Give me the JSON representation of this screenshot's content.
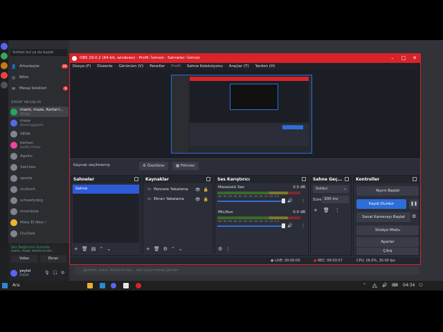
{
  "discord": {
    "search_placeholder": "Sohbet bul ya da başlat",
    "nav": [
      {
        "label": "Arkadaşlar",
        "icon": "friends-icon",
        "badge": "28"
      },
      {
        "label": "Nitro",
        "icon": "nitro-icon",
        "badge": ""
      },
      {
        "label": "Mesaj İstekleri",
        "icon": "mail-icon",
        "badge": "8"
      }
    ],
    "dm_header": "DİREKT MESAJLAR",
    "dms": [
      {
        "name": "mami, maze, Kartal-İ...",
        "sub": "10 Üye",
        "color": "#23a55a"
      },
      {
        "name": "maze",
        "sub": "discord.gg/jakeik",
        "color": "#5865f2"
      },
      {
        "name": "SENA",
        "sub": "",
        "color": "#80848e"
      },
      {
        "name": "berkan",
        "sub": "Spotify dinliyor",
        "color": "#eb459e"
      },
      {
        "name": "Agaitu",
        "sub": "",
        "color": "#80848e"
      },
      {
        "name": "Swichex",
        "sub": "",
        "color": "#80848e"
      },
      {
        "name": "spezia",
        "sub": "",
        "color": "#80848e"
      },
      {
        "name": "ciciksoh",
        "sub": "",
        "color": "#80848e"
      },
      {
        "name": "schawtydog",
        "sub": "",
        "color": "#80848e"
      },
      {
        "name": "moonbow",
        "sub": "",
        "color": "#80848e"
      },
      {
        "name": "Mete El Niko !",
        "sub": "",
        "color": "#f0b232"
      },
      {
        "name": "DuySad",
        "sub": "",
        "color": "#80848e"
      }
    ],
    "voice": {
      "status": "Ses Bağlantısı Kuruldu",
      "channel": "mami, maze, Kartal-İv-Her...",
      "video_label": "Video",
      "screen_label": "Ekran"
    },
    "user": {
      "name": "yeylol",
      "tag": "#0000"
    },
    "chat_placeholder": "@mami, maze, Kartal-İv-Her... adlı kişiye mesaj gönder"
  },
  "obs": {
    "title": "OBS 29.0.2 (64-bit, windows) - Profil: İsimsiz - Sahneler: İsimsiz",
    "menu": [
      "Dosya (F)",
      "Düzenle",
      "Görünüm (V)",
      "Paneller",
      "Profil",
      "Sahne Koleksiyonu",
      "Araçlar (T)",
      "Yardım (H)"
    ],
    "source_toolbar": {
      "label": "Kaynak seçilmemiş",
      "properties": "Özellikler",
      "filters": "Filtreler"
    },
    "docks": {
      "scenes": {
        "title": "Sahneler",
        "items": [
          "Sahne"
        ]
      },
      "sources": {
        "title": "Kaynaklar",
        "items": [
          "Pencere Yakalama",
          "Ekran Yakalama"
        ]
      },
      "mixer": {
        "title": "Ses Karıştırıcı",
        "channels": [
          {
            "name": "Masaüstü Ses",
            "db": "0.0 dB"
          },
          {
            "name": "Mic/Aux",
            "db": "0.0 dB"
          }
        ],
        "ticks": "-60 -55 -50 -45 -40 -35 -30 -25 -20 -15 -10 -5 0"
      },
      "transitions": {
        "title": "Sahne Geç...",
        "type": "Soldur",
        "duration_label": "Süre",
        "duration_value": "300 ms"
      },
      "controls": {
        "title": "Kontroller",
        "buttons": [
          "Yayını Başlat",
          "Kaydı Durdur",
          "Sanal Kamerayı Başlat",
          "Stüdyo Modu",
          "Ayarlar",
          "Çıkış"
        ]
      }
    },
    "status": {
      "live": "LIVE: 00:00:00",
      "rec": "REC: 00:03:57",
      "cpu": "CPU: 26.0%, 30.00 fps"
    }
  },
  "taskbar": {
    "search_label": "Ara",
    "time": "04:34"
  }
}
